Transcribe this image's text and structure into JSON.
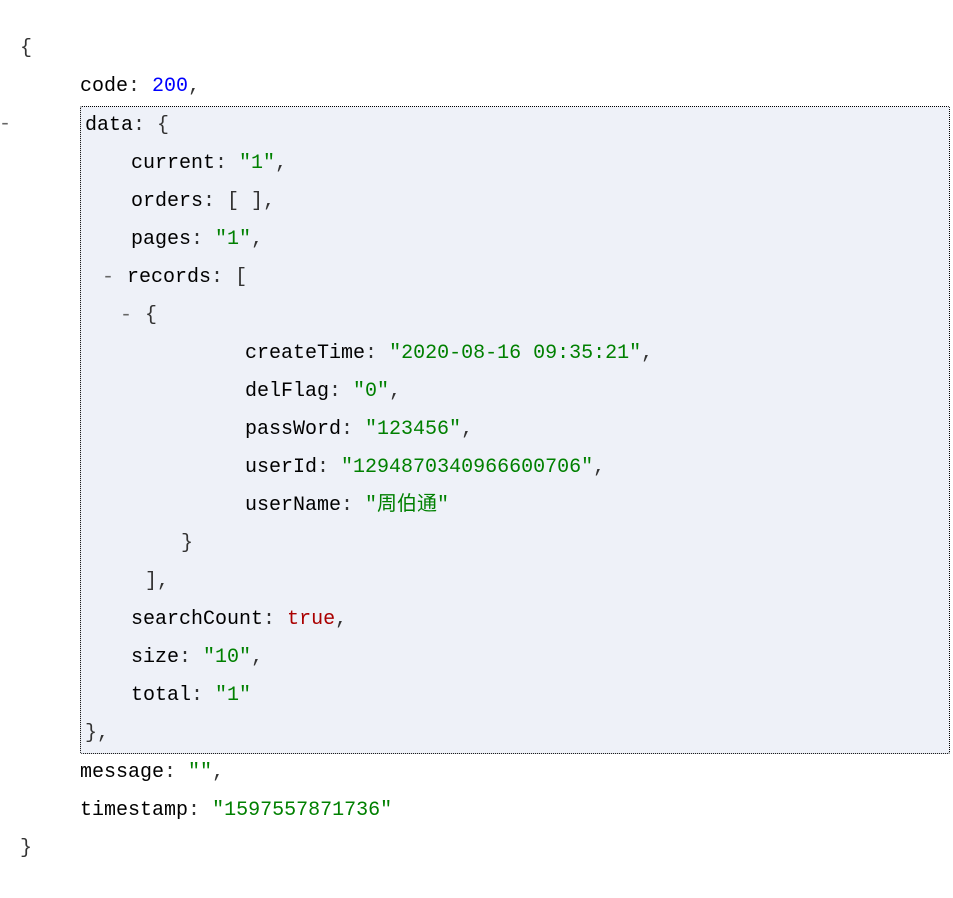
{
  "keys": {
    "code": "code",
    "data": "data",
    "current": "current",
    "orders": "orders",
    "pages": "pages",
    "records": "records",
    "createTime": "createTime",
    "delFlag": "delFlag",
    "passWord": "passWord",
    "userId": "userId",
    "userName": "userName",
    "searchCount": "searchCount",
    "size": "size",
    "total": "total",
    "message": "message",
    "timestamp": "timestamp"
  },
  "values": {
    "code": "200",
    "current": "\"1\"",
    "orders": "[ ]",
    "pages": "\"1\"",
    "createTime": "\"2020-08-16 09:35:21\"",
    "delFlag": "\"0\"",
    "passWord": "\"123456\"",
    "userId": "\"1294870340966600706\"",
    "userName": "\"周伯通\"",
    "searchCount": "true",
    "size": "\"10\"",
    "total": "\"1\"",
    "message": "\"\"",
    "timestamp": "\"1597557871736\""
  },
  "glyphs": {
    "minus": "-",
    "colon": ":",
    "comma": ",",
    "openBrace": "{",
    "closeBrace": "}",
    "openBracket": "[",
    "closeBracket": "]"
  }
}
